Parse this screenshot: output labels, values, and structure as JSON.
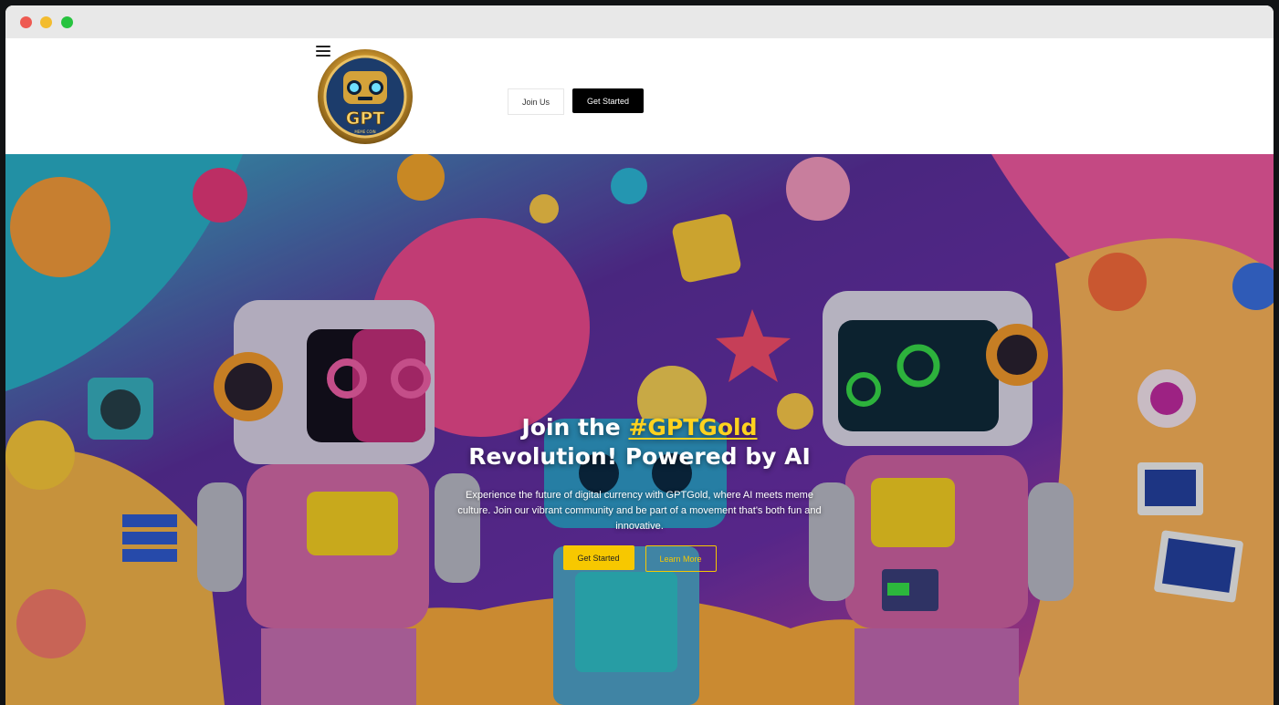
{
  "colors": {
    "accent_yellow": "#f7c800",
    "headline_highlight": "#ffd21f",
    "nav_button_dark": "#000000"
  },
  "nav": {
    "menu_icon": "hamburger-icon",
    "logo_text": "GPT",
    "logo_subtext": "MEME COIN",
    "join_label": "Join Us",
    "get_started_label": "Get Started"
  },
  "hero": {
    "headline_pre": "Join the ",
    "headline_hashtag": "#GPTGold",
    "headline_post": "Revolution! Powered by AI",
    "subtitle": "Experience the future of digital currency with GPTGold, where AI meets meme culture. Join our vibrant community and be part of a movement that's both fun and innovative.",
    "get_started_label": "Get Started",
    "learn_more_label": "Learn More"
  }
}
